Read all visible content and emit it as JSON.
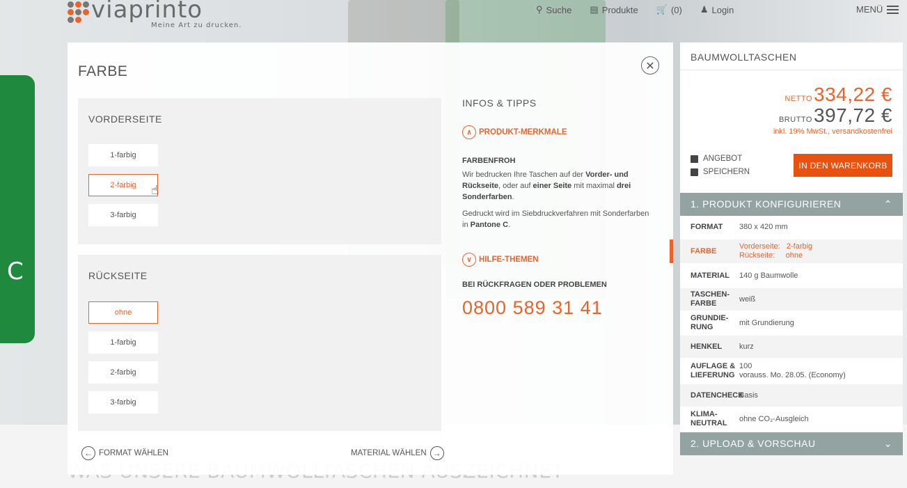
{
  "header": {
    "logo_word": "viaprinto",
    "logo_tagline": "Meine Art zu drucken.",
    "nav": [
      {
        "label": "Suche",
        "icon": "search-icon"
      },
      {
        "label": "Produkte",
        "icon": "products-icon"
      },
      {
        "label": "(0)",
        "icon": "cart-icon"
      },
      {
        "label": "Login",
        "icon": "user-icon"
      }
    ],
    "menu_label": "MENÜ",
    "brand_colors": {
      "orange": "#e8642b",
      "gray": "#6a6a6a"
    }
  },
  "panel": {
    "title": "FARBE",
    "close_icon": "close-icon",
    "front": {
      "title": "VORDERSEITE",
      "options": [
        "1-farbig",
        "2-farbig",
        "3-farbig"
      ],
      "selected": "2-farbig"
    },
    "back": {
      "title": "RÜCKSEITE",
      "options": [
        "ohne",
        "1-farbig",
        "2-farbig",
        "3-farbig"
      ],
      "selected": "ohne"
    },
    "prev_label": "FORMAT WÄHLEN",
    "next_label": "MATERIAL WÄHLEN",
    "info": {
      "heading": "INFOS & TIPPS",
      "acc1_label": "PRODUKT-MERKMALE",
      "sub_heading": "FARBENFROH",
      "p1_a": "Wir bedrucken Ihre Taschen auf der ",
      "p1_b": "Vorder- und Rückseite",
      "p1_c": ", oder auf ",
      "p1_d": "einer Seite",
      "p1_e": " mit maximal ",
      "p1_f": "drei Sonderfarben",
      "p1_g": ".",
      "p2_a": "Gedruckt wird im Siebdruckverfahren mit Sonderfarben in ",
      "p2_b": "Pantone C",
      "p2_c": ".",
      "acc2_label": "HILFE-THEMEN",
      "contact_heading": "BEI RÜCKFRAGEN ODER PROBLEMEN",
      "phone": "0800 589 31 41"
    }
  },
  "below_text": "WAS UNSERE BAUMWOLLTASCHEN AUSZEICHNET",
  "sidebar": {
    "product": "BAUMWOLLTASCHEN",
    "netto_label": "NETTO",
    "netto_value": "334,22 €",
    "brutto_label": "BRUTTO",
    "brutto_value": "397,72 €",
    "vat_note": "inkl. 19% MwSt., versandkostenfrei",
    "offer_label": "ANGEBOT",
    "save_label": "SPEICHERN",
    "cart_button": "IN DEN WARENKORB",
    "section1": "1. PRODUKT KONFIGURIEREN",
    "section2": "2. UPLOAD & VORSCHAU",
    "config": [
      {
        "key": "FORMAT",
        "value": "380 x 420 mm"
      },
      {
        "key": "FARBE",
        "value": "Vorderseite:   2-farbig\nRückseite:     ohne",
        "active": true
      },
      {
        "key": "MATERIAL",
        "value": "140 g Baumwolle"
      },
      {
        "key": "TASCHEN-\nFARBE",
        "value": "weiß"
      },
      {
        "key": "GRUNDIE-\nRUNG",
        "value": "mit Grundierung"
      },
      {
        "key": "HENKEL",
        "value": "kurz"
      },
      {
        "key": "AUFLAGE &\nLIEFERUNG",
        "value": "100\nvorauss. Mo. 28.05. (Economy)"
      },
      {
        "key": "DATENCHECK",
        "value": "Basis"
      },
      {
        "key": "KLIMA-\nNEUTRAL",
        "value": "ohne CO₂-Ausgleich"
      }
    ]
  }
}
